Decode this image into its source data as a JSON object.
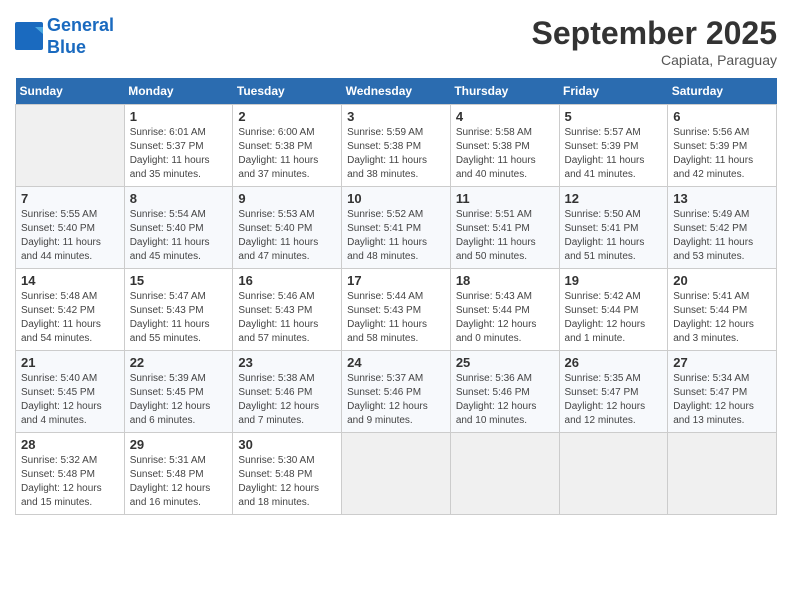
{
  "header": {
    "logo_line1": "General",
    "logo_line2": "Blue",
    "month": "September 2025",
    "location": "Capiata, Paraguay"
  },
  "days_of_week": [
    "Sunday",
    "Monday",
    "Tuesday",
    "Wednesday",
    "Thursday",
    "Friday",
    "Saturday"
  ],
  "weeks": [
    [
      {
        "day": "",
        "info": ""
      },
      {
        "day": "1",
        "info": "Sunrise: 6:01 AM\nSunset: 5:37 PM\nDaylight: 11 hours\nand 35 minutes."
      },
      {
        "day": "2",
        "info": "Sunrise: 6:00 AM\nSunset: 5:38 PM\nDaylight: 11 hours\nand 37 minutes."
      },
      {
        "day": "3",
        "info": "Sunrise: 5:59 AM\nSunset: 5:38 PM\nDaylight: 11 hours\nand 38 minutes."
      },
      {
        "day": "4",
        "info": "Sunrise: 5:58 AM\nSunset: 5:38 PM\nDaylight: 11 hours\nand 40 minutes."
      },
      {
        "day": "5",
        "info": "Sunrise: 5:57 AM\nSunset: 5:39 PM\nDaylight: 11 hours\nand 41 minutes."
      },
      {
        "day": "6",
        "info": "Sunrise: 5:56 AM\nSunset: 5:39 PM\nDaylight: 11 hours\nand 42 minutes."
      }
    ],
    [
      {
        "day": "7",
        "info": "Sunrise: 5:55 AM\nSunset: 5:40 PM\nDaylight: 11 hours\nand 44 minutes."
      },
      {
        "day": "8",
        "info": "Sunrise: 5:54 AM\nSunset: 5:40 PM\nDaylight: 11 hours\nand 45 minutes."
      },
      {
        "day": "9",
        "info": "Sunrise: 5:53 AM\nSunset: 5:40 PM\nDaylight: 11 hours\nand 47 minutes."
      },
      {
        "day": "10",
        "info": "Sunrise: 5:52 AM\nSunset: 5:41 PM\nDaylight: 11 hours\nand 48 minutes."
      },
      {
        "day": "11",
        "info": "Sunrise: 5:51 AM\nSunset: 5:41 PM\nDaylight: 11 hours\nand 50 minutes."
      },
      {
        "day": "12",
        "info": "Sunrise: 5:50 AM\nSunset: 5:41 PM\nDaylight: 11 hours\nand 51 minutes."
      },
      {
        "day": "13",
        "info": "Sunrise: 5:49 AM\nSunset: 5:42 PM\nDaylight: 11 hours\nand 53 minutes."
      }
    ],
    [
      {
        "day": "14",
        "info": "Sunrise: 5:48 AM\nSunset: 5:42 PM\nDaylight: 11 hours\nand 54 minutes."
      },
      {
        "day": "15",
        "info": "Sunrise: 5:47 AM\nSunset: 5:43 PM\nDaylight: 11 hours\nand 55 minutes."
      },
      {
        "day": "16",
        "info": "Sunrise: 5:46 AM\nSunset: 5:43 PM\nDaylight: 11 hours\nand 57 minutes."
      },
      {
        "day": "17",
        "info": "Sunrise: 5:44 AM\nSunset: 5:43 PM\nDaylight: 11 hours\nand 58 minutes."
      },
      {
        "day": "18",
        "info": "Sunrise: 5:43 AM\nSunset: 5:44 PM\nDaylight: 12 hours\nand 0 minutes."
      },
      {
        "day": "19",
        "info": "Sunrise: 5:42 AM\nSunset: 5:44 PM\nDaylight: 12 hours\nand 1 minute."
      },
      {
        "day": "20",
        "info": "Sunrise: 5:41 AM\nSunset: 5:44 PM\nDaylight: 12 hours\nand 3 minutes."
      }
    ],
    [
      {
        "day": "21",
        "info": "Sunrise: 5:40 AM\nSunset: 5:45 PM\nDaylight: 12 hours\nand 4 minutes."
      },
      {
        "day": "22",
        "info": "Sunrise: 5:39 AM\nSunset: 5:45 PM\nDaylight: 12 hours\nand 6 minutes."
      },
      {
        "day": "23",
        "info": "Sunrise: 5:38 AM\nSunset: 5:46 PM\nDaylight: 12 hours\nand 7 minutes."
      },
      {
        "day": "24",
        "info": "Sunrise: 5:37 AM\nSunset: 5:46 PM\nDaylight: 12 hours\nand 9 minutes."
      },
      {
        "day": "25",
        "info": "Sunrise: 5:36 AM\nSunset: 5:46 PM\nDaylight: 12 hours\nand 10 minutes."
      },
      {
        "day": "26",
        "info": "Sunrise: 5:35 AM\nSunset: 5:47 PM\nDaylight: 12 hours\nand 12 minutes."
      },
      {
        "day": "27",
        "info": "Sunrise: 5:34 AM\nSunset: 5:47 PM\nDaylight: 12 hours\nand 13 minutes."
      }
    ],
    [
      {
        "day": "28",
        "info": "Sunrise: 5:32 AM\nSunset: 5:48 PM\nDaylight: 12 hours\nand 15 minutes."
      },
      {
        "day": "29",
        "info": "Sunrise: 5:31 AM\nSunset: 5:48 PM\nDaylight: 12 hours\nand 16 minutes."
      },
      {
        "day": "30",
        "info": "Sunrise: 5:30 AM\nSunset: 5:48 PM\nDaylight: 12 hours\nand 18 minutes."
      },
      {
        "day": "",
        "info": ""
      },
      {
        "day": "",
        "info": ""
      },
      {
        "day": "",
        "info": ""
      },
      {
        "day": "",
        "info": ""
      }
    ]
  ]
}
